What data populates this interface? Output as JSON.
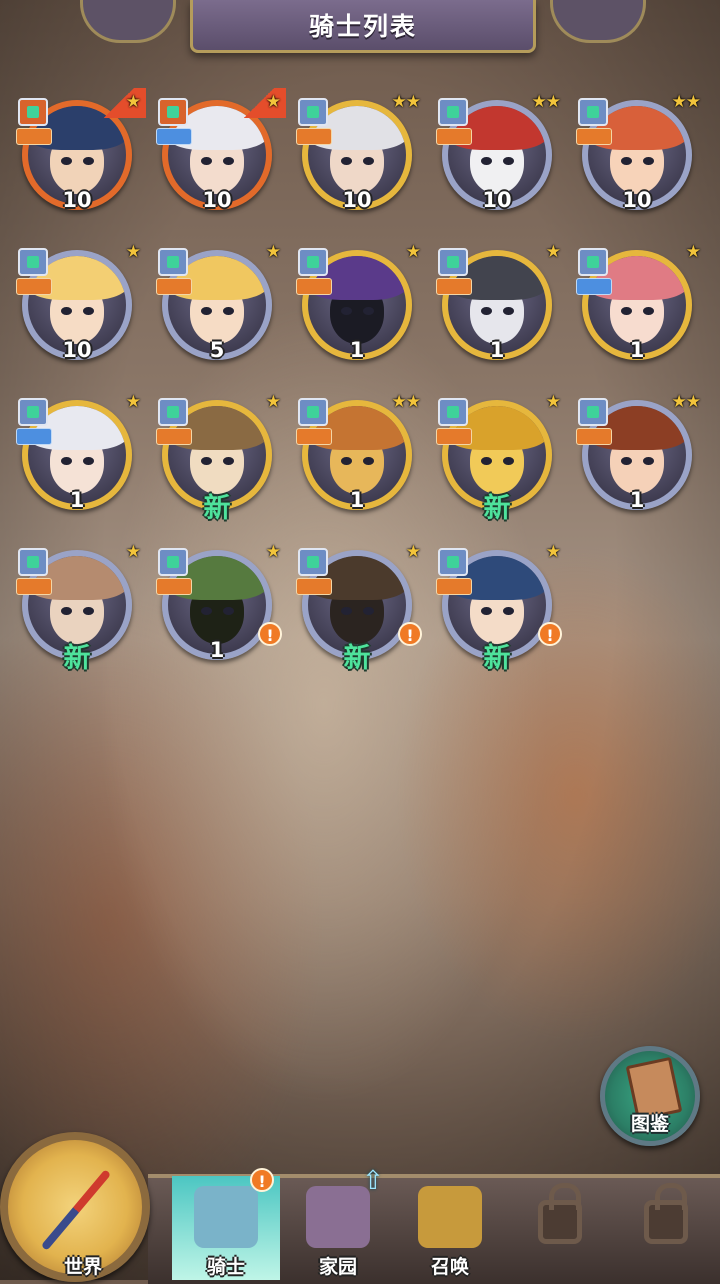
{
  "header": {
    "title": "骑士列表"
  },
  "colors": {
    "new_tag": "#4ee39c",
    "alert": "#f07a25",
    "title_banner": "#6b5c7d"
  },
  "knights": [
    {
      "rarity": "orange",
      "stars": "★",
      "level": "10",
      "is_new": false,
      "alert": false,
      "role": "orange",
      "hair": "#2b3f6b",
      "skin": "#f1d3b8"
    },
    {
      "rarity": "orange",
      "stars": "★",
      "level": "10",
      "is_new": false,
      "alert": false,
      "role": "blue",
      "hair": "#e9e9ef",
      "skin": "#f3dccd"
    },
    {
      "rarity": "gold",
      "stars": "★★",
      "level": "10",
      "is_new": false,
      "alert": false,
      "role": "orange",
      "hair": "#e1e1e6",
      "skin": "#efd8c8"
    },
    {
      "rarity": "silver",
      "stars": "★★",
      "level": "10",
      "is_new": false,
      "alert": false,
      "role": "orange",
      "hair": "#c2372f",
      "skin": "#f0f0f2"
    },
    {
      "rarity": "silver",
      "stars": "★★",
      "level": "10",
      "is_new": false,
      "alert": false,
      "role": "orange",
      "hair": "#d8603a",
      "skin": "#f7d3b9"
    },
    {
      "rarity": "silver",
      "stars": "★",
      "level": "10",
      "is_new": false,
      "alert": false,
      "role": "orange",
      "hair": "#f3cf73",
      "skin": "#f6dcc5"
    },
    {
      "rarity": "silver",
      "stars": "★",
      "level": "5",
      "is_new": false,
      "alert": false,
      "role": "orange",
      "hair": "#f0c760",
      "skin": "#f6dcc5"
    },
    {
      "rarity": "gold",
      "stars": "★",
      "level": "1",
      "is_new": false,
      "alert": false,
      "role": "orange",
      "hair": "#5a3a8a",
      "skin": "#1b1b24"
    },
    {
      "rarity": "gold",
      "stars": "★",
      "level": "1",
      "is_new": false,
      "alert": false,
      "role": "orange",
      "hair": "#42444e",
      "skin": "#e6e6ec"
    },
    {
      "rarity": "gold",
      "stars": "★",
      "level": "1",
      "is_new": false,
      "alert": false,
      "role": "blue",
      "hair": "#e07b84",
      "skin": "#f7dccf"
    },
    {
      "rarity": "gold",
      "stars": "★",
      "level": "1",
      "is_new": false,
      "alert": false,
      "role": "blue",
      "hair": "#e8e9f0",
      "skin": "#f5e2d6"
    },
    {
      "rarity": "gold",
      "stars": "★",
      "level": "",
      "is_new": true,
      "alert": false,
      "role": "orange",
      "hair": "#8a6a43",
      "skin": "#f0dcc1"
    },
    {
      "rarity": "gold",
      "stars": "★★",
      "level": "1",
      "is_new": false,
      "alert": false,
      "role": "orange",
      "hair": "#c57432",
      "skin": "#e7b75a"
    },
    {
      "rarity": "gold",
      "stars": "★",
      "level": "",
      "is_new": true,
      "alert": false,
      "role": "orange",
      "hair": "#d9a22b",
      "skin": "#f1ca58"
    },
    {
      "rarity": "silver",
      "stars": "★★",
      "level": "1",
      "is_new": false,
      "alert": false,
      "role": "orange",
      "hair": "#8c3e24",
      "skin": "#f5d1b8"
    },
    {
      "rarity": "silver",
      "stars": "★",
      "level": "",
      "is_new": true,
      "alert": false,
      "role": "orange",
      "hair": "#b58b6f",
      "skin": "#ead3bf"
    },
    {
      "rarity": "silver",
      "stars": "★",
      "level": "1",
      "is_new": false,
      "alert": true,
      "role": "orange",
      "hair": "#567a3f",
      "skin": "#1e2216"
    },
    {
      "rarity": "silver",
      "stars": "★",
      "level": "",
      "is_new": true,
      "alert": true,
      "role": "orange",
      "hair": "#4b3a2c",
      "skin": "#2b2420"
    },
    {
      "rarity": "silver",
      "stars": "★",
      "level": "",
      "is_new": true,
      "alert": true,
      "role": "orange",
      "hair": "#2e4a7a",
      "skin": "#f4dcc8"
    }
  ],
  "new_label": "新",
  "alert_mark": "!",
  "codex": {
    "label": "图鉴"
  },
  "nav": {
    "world": "世界",
    "items": [
      {
        "label": "骑士",
        "active": true,
        "icon": "knight-icon",
        "color": "#7ab3c9"
      },
      {
        "label": "家园",
        "active": false,
        "icon": "home-icon",
        "color": "#8a6f93"
      },
      {
        "label": "召唤",
        "active": false,
        "icon": "train-icon",
        "color": "#c79a3c"
      },
      {
        "label": "",
        "active": false,
        "icon": "lock-icon",
        "color": "#4c3c33"
      },
      {
        "label": "",
        "active": false,
        "icon": "lock-icon",
        "color": "#4c3c33"
      }
    ],
    "up_arrow": "⇧"
  }
}
